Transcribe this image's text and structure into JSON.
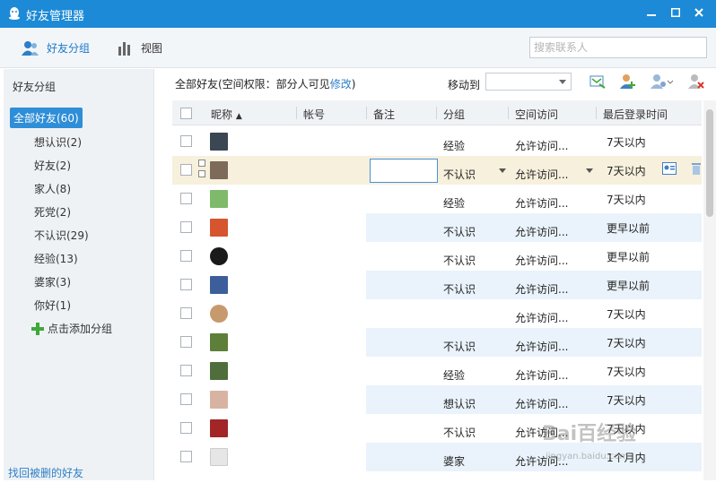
{
  "window": {
    "title": "好友管理器",
    "controls": [
      "minimize",
      "maximize",
      "close"
    ],
    "title_bar_color": "#1c8ad6"
  },
  "toolbar": {
    "tabs": [
      {
        "label": "好友分组",
        "icon": "friends-icon",
        "active": true
      },
      {
        "label": "视图",
        "icon": "chart-icon",
        "active": false
      }
    ],
    "search_placeholder": "搜索联系人"
  },
  "sidebar": {
    "header": "好友分组",
    "groups": [
      {
        "label": "全部好友(60)",
        "selected": true
      },
      {
        "label": "想认识(2)"
      },
      {
        "label": "好友(2)"
      },
      {
        "label": "家人(8)"
      },
      {
        "label": "死党(2)"
      },
      {
        "label": "不认识(29)"
      },
      {
        "label": "经验(13)"
      },
      {
        "label": "婆家(3)"
      },
      {
        "label": "你好(1)"
      }
    ],
    "add_group": "点击添加分组",
    "footer_link": "找回被删的好友"
  },
  "infobar": {
    "text": "全部好友(空间权限：部分人可见",
    "link": "修改",
    "close": ")"
  },
  "move_to": {
    "label": "移动到",
    "value": ""
  },
  "actions": [
    "send-message-icon",
    "add-friend-icon",
    "friend-settings-icon",
    "delete-friend-icon"
  ],
  "table": {
    "headers": {
      "nickname": "昵称",
      "account": "帐号",
      "remark": "备注",
      "group": "分组",
      "space": "空间访问",
      "last_login": "最后登录时间"
    },
    "rows": [
      {
        "group": "经验",
        "space": "允许访问...",
        "last_login": "7天以内",
        "avatar": "#3b4752"
      },
      {
        "group": "不认识",
        "space": "允许访问...",
        "last_login": "7天以内",
        "avatar": "#7d6a58",
        "highlight": true
      },
      {
        "group": "经验",
        "space": "允许访问...",
        "last_login": "7天以内",
        "avatar": "#7fb96a"
      },
      {
        "group": "不认识",
        "space": "允许访问...",
        "last_login": "更早以前",
        "avatar": "#d6542e"
      },
      {
        "group": "不认识",
        "space": "允许访问...",
        "last_login": "更早以前",
        "avatar": "#1a1a1a"
      },
      {
        "group": "不认识",
        "space": "允许访问...",
        "last_login": "更早以前",
        "avatar": "#3c5f9c"
      },
      {
        "group": "",
        "space": "允许访问...",
        "last_login": "7天以内",
        "avatar": "#c79a6e"
      },
      {
        "group": "不认识",
        "space": "允许访问...",
        "last_login": "7天以内",
        "avatar": "#5e7f3a"
      },
      {
        "group": "经验",
        "space": "允许访问...",
        "last_login": "7天以内",
        "avatar": "#4f6e3b"
      },
      {
        "group": "想认识",
        "space": "允许访问...",
        "last_login": "7天以内",
        "avatar": "#d9b3a1"
      },
      {
        "group": "不认识",
        "space": "允许访问...",
        "last_login": "7天以内",
        "avatar": "#a22626"
      },
      {
        "group": "婆家",
        "space": "允许访问...",
        "last_login": "1个月内",
        "avatar": "#e6e6e6"
      }
    ]
  },
  "watermark": {
    "main": "Bai百经验",
    "sub": "jingyan.baidu.com"
  }
}
